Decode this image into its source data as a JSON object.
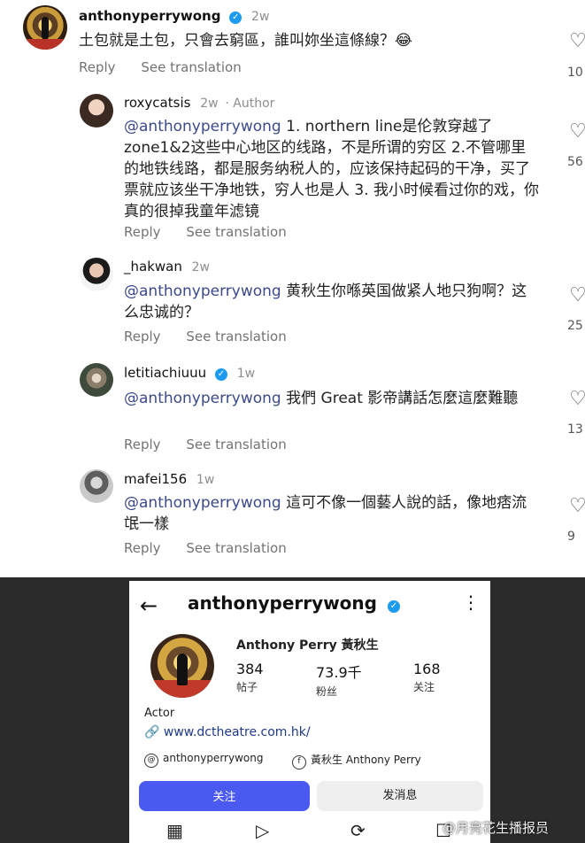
{
  "actions": {
    "reply": "Reply",
    "see_translation": "See translation"
  },
  "comments": [
    {
      "username": "anthonyperrywong",
      "verified": true,
      "time": "2w",
      "author_tag": "",
      "text": "土包就是土包，只會去窮區，誰叫妳坐這條線？😂",
      "mention": "",
      "likes": "10"
    },
    {
      "username": "roxycatsis",
      "verified": false,
      "time": "2w",
      "author_tag": "· Author",
      "mention": "@anthonyperrywong",
      "text": " 1. northern line是伦敦穿越了zone1&2这些中心地区的线路，不是所谓的穷区 2.不管哪里的地铁线路，都是服务纳税人的，应该保持起码的干净，买了票就应该坐干净地铁，穷人也是人 3. 我小时候看过你的戏，你真的很掉我童年滤镜",
      "likes": "56"
    },
    {
      "username": "_hakwan",
      "verified": false,
      "time": "2w",
      "author_tag": "",
      "mention": "@anthonyperrywong",
      "text": " 黄秋生你喺英国做紧人地只狗啊？这么忠诚的？",
      "likes": "25"
    },
    {
      "username": "letitiachiuuu",
      "verified": true,
      "time": "1w",
      "author_tag": "",
      "mention": "@anthonyperrywong",
      "text": " 我們 Great 影帝講話怎麼這麼難聽",
      "likes": "13"
    },
    {
      "username": "mafei156",
      "verified": false,
      "time": "1w",
      "author_tag": "",
      "mention": "@anthonyperrywong",
      "text": " 這可不像一個藝人說的話，像地痞流氓一樣",
      "likes": "9"
    }
  ],
  "profile": {
    "username": "anthonyperrywong",
    "full_name": "Anthony Perry 黃秋生",
    "stats": [
      {
        "value": "384",
        "label": "帖子"
      },
      {
        "value": "73.9千",
        "label": "粉丝"
      },
      {
        "value": "168",
        "label": "关注"
      }
    ],
    "bio": "Actor",
    "link": "www.dctheatre.com.hk/",
    "threads_handle": "anthonyperrywong",
    "facebook_name": "黃秋生 Anthony Perry",
    "follow_label": "关注",
    "message_label": "发消息"
  },
  "watermark": "@月亮花生播报员",
  "colors": {
    "mention": "#3c4a8a",
    "follow_button": "#4a5af0",
    "verified": "#1d9bf0"
  }
}
